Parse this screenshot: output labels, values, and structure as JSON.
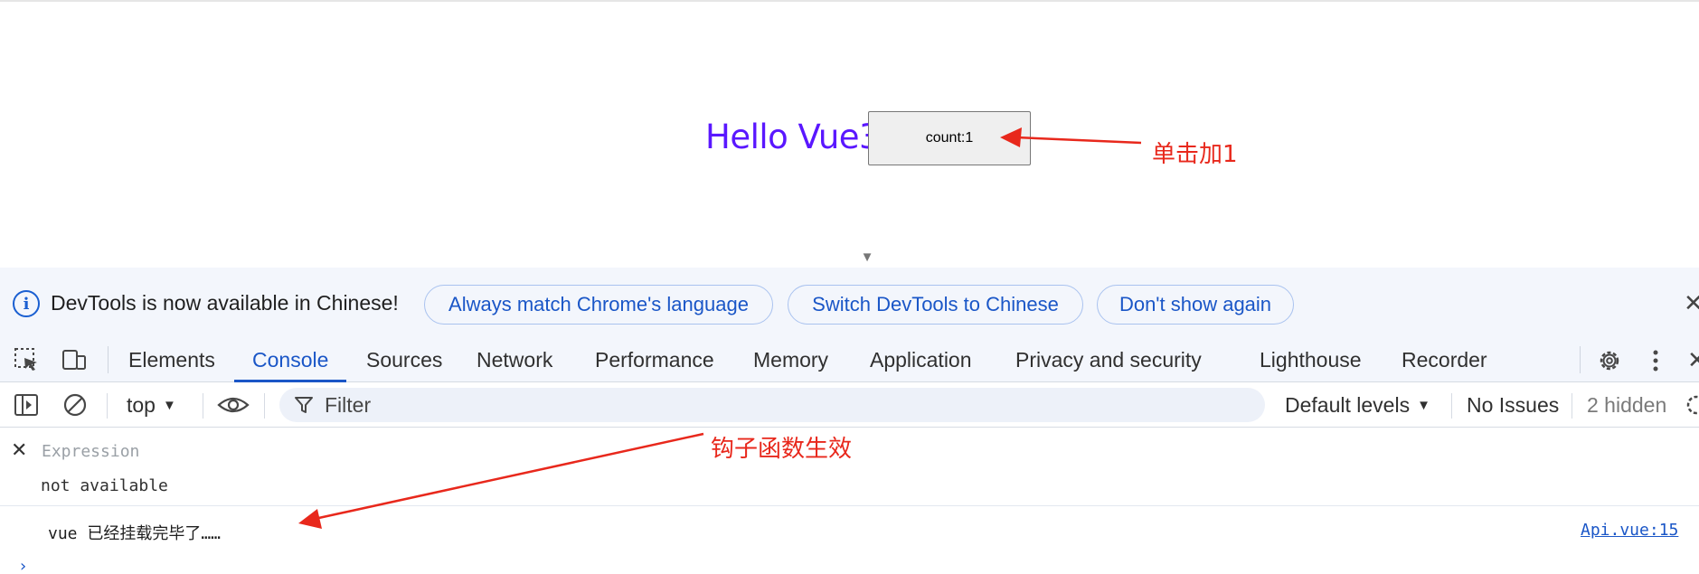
{
  "page": {
    "heading": "Hello Vue3",
    "count_button": "count:1",
    "annotation_click": "单击加1",
    "annotation_hook": "钩子函数生效"
  },
  "devtools": {
    "info_bar": {
      "message": "DevTools is now available in Chinese!",
      "btn_match": "Always match Chrome's language",
      "btn_switch": "Switch DevTools to Chinese",
      "btn_dismiss": "Don't show again",
      "close": "✕"
    },
    "tabs": [
      {
        "label": "Elements"
      },
      {
        "label": "Console"
      },
      {
        "label": "Sources"
      },
      {
        "label": "Network"
      },
      {
        "label": "Performance"
      },
      {
        "label": "Memory"
      },
      {
        "label": "Application"
      },
      {
        "label": "Privacy and security"
      },
      {
        "label": "Lighthouse"
      },
      {
        "label": "Recorder"
      }
    ],
    "active_tab": "Console",
    "tabs_close": "✕",
    "toolbar": {
      "context": "top",
      "filter_placeholder": "Filter",
      "levels": "Default levels",
      "issues": "No Issues",
      "hidden": "2 hidden"
    },
    "console": {
      "expression_placeholder": "Expression",
      "expression_result": "not available",
      "log_message": "vue 已经挂载完毕了……",
      "log_source": "Api.vue:15",
      "prompt": "›"
    }
  },
  "colors": {
    "heading": "#5a17ff",
    "annotation": "#e8281c",
    "accent": "#1a56c7",
    "infobar_bg": "#f3f6fc"
  }
}
